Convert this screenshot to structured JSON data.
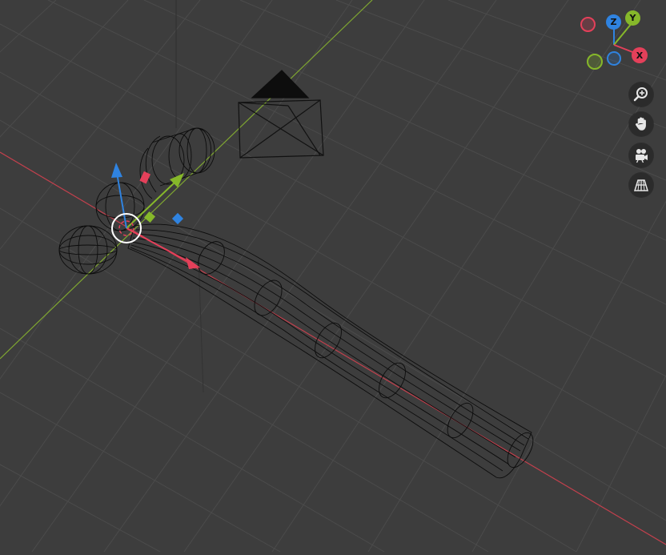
{
  "viewport": {
    "background": "#3d3d3d",
    "grid_line_color": "#4a4a4a",
    "x_axis_color": "#c2404d",
    "y_axis_color": "#7fa631",
    "object": "hammer",
    "display_mode": "wireframe"
  },
  "navigation_gizmo": {
    "z_label": "Z",
    "y_label": "Y",
    "x_label": "X",
    "colors": {
      "x": "#e4405a",
      "y": "#86b82a",
      "z": "#2f83e0"
    }
  },
  "toolbar": {
    "zoom_icon": "zoom-in-icon",
    "pan_icon": "hand-icon",
    "camera_icon": "camera-icon",
    "perspective_icon": "grid-perspective-icon"
  }
}
